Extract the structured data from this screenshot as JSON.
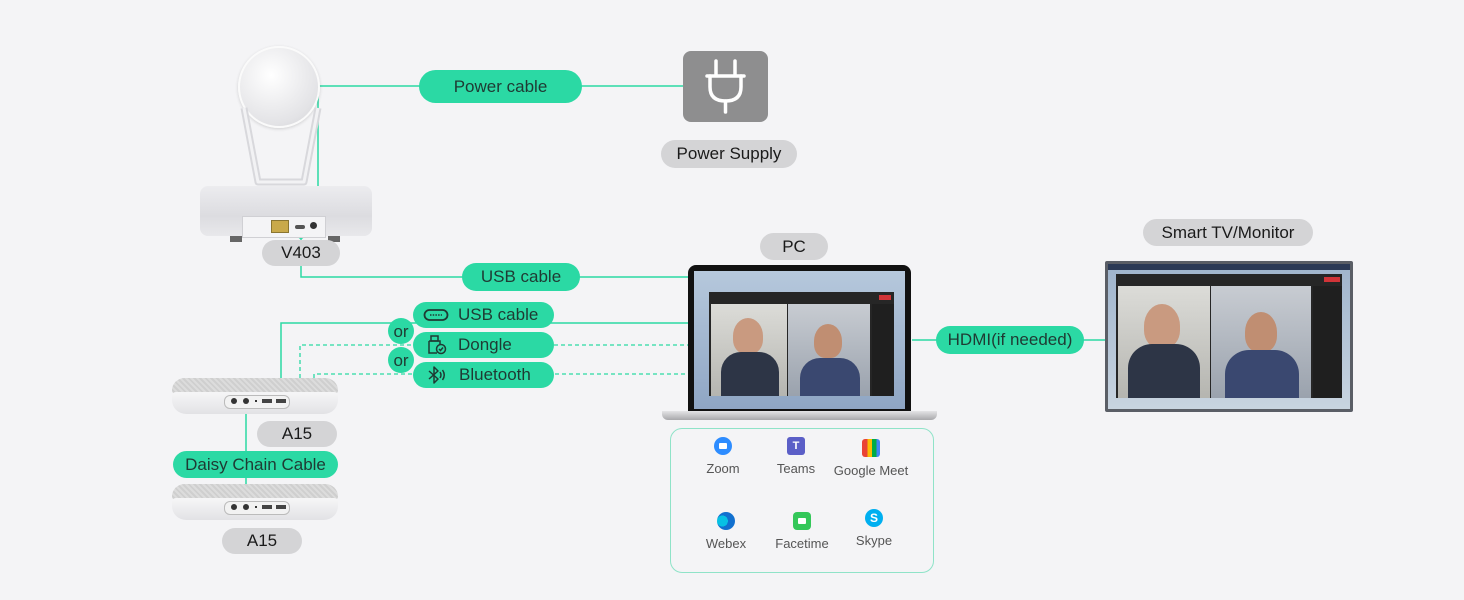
{
  "devices": {
    "camera": "V403",
    "power_supply": "Power Supply",
    "speaker_1": "A15",
    "speaker_2": "A15",
    "pc": "PC",
    "display": "Smart TV/Monitor"
  },
  "cables": {
    "power": "Power cable",
    "usb_camera": "USB cable",
    "usb_speaker": "USB cable",
    "dongle": "Dongle",
    "bluetooth": "Bluetooth",
    "daisy_chain": "Daisy Chain Cable",
    "hdmi": "HDMI(if needed)"
  },
  "or_label": "or",
  "apps": [
    {
      "name": "Zoom",
      "icon": "zoom-icon",
      "color": "#2d8cff"
    },
    {
      "name": "Teams",
      "icon": "teams-icon",
      "color": "#5b5fc7"
    },
    {
      "name": "Google Meet",
      "icon": "google-meet-icon",
      "color": "#00ac47"
    },
    {
      "name": "Webex",
      "icon": "webex-icon",
      "color": "#1170cf"
    },
    {
      "name": "Facetime",
      "icon": "facetime-icon",
      "color": "#34c759"
    },
    {
      "name": "Skype",
      "icon": "skype-icon",
      "color": "#00aff0"
    }
  ],
  "colors": {
    "accent": "#2bd9a4",
    "label_gray": "#d4d4d6",
    "background": "#f4f4f6"
  }
}
